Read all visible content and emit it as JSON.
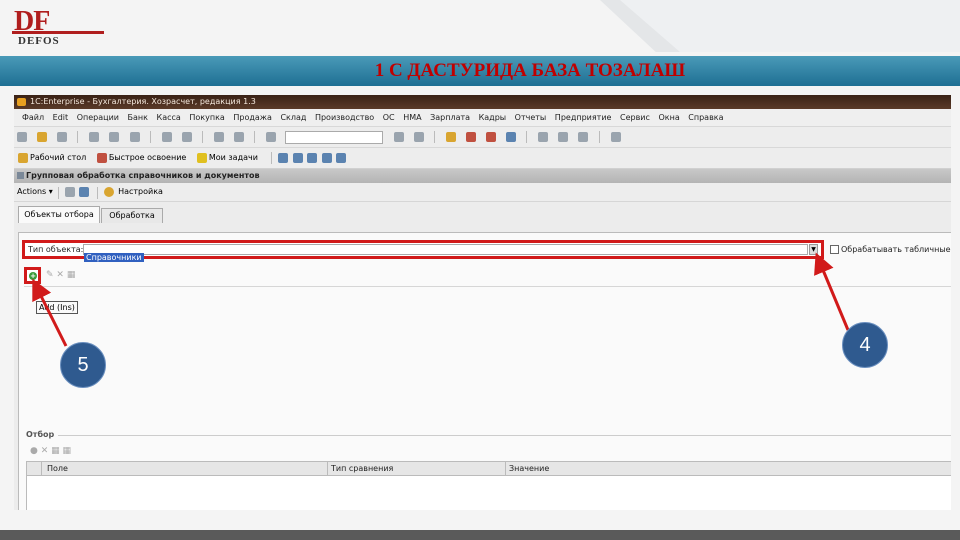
{
  "logo": {
    "big": "DF",
    "small": "DEFOS"
  },
  "slide": {
    "title": "1 С ДАСТУРИДА БАЗА ТОЗАЛАШ"
  },
  "app": {
    "window_title": "1C:Enterprise - Бухгалтерия. Хозрасчет, редакция 1.3",
    "menu": [
      "Файл",
      "Edit",
      "Операции",
      "Банк",
      "Касса",
      "Покупка",
      "Продажа",
      "Склад",
      "Производство",
      "ОС",
      "НМА",
      "Зарплата",
      "Кадры",
      "Отчеты",
      "Предприятие",
      "Сервис",
      "Окна",
      "Справка"
    ],
    "toolbar2": {
      "desktop": "Рабочий стол",
      "quick_start": "Быстрое освоение",
      "my_tasks": "Мои задачи"
    },
    "subwindow_title": "Групповая обработка справочников и документов",
    "actions": {
      "label": "Actions ▾",
      "settings": "Настройка"
    },
    "tabs": [
      {
        "label": "Объекты отбора",
        "active": true
      },
      {
        "label": "Обработка",
        "active": false
      }
    ],
    "object_type": {
      "label": "Тип объекта:",
      "value": "Справочники"
    },
    "checkbox_label": "Обрабатывать табличные ча",
    "tooltip": "Add (Ins)",
    "filter": {
      "label": "Отбор",
      "columns": [
        "Поле",
        "Тип сравнения",
        "Значение"
      ]
    }
  },
  "callouts": {
    "five": "5",
    "four": "4"
  },
  "colors": {
    "banner": "#1e6f93",
    "highlight": "#d11a1a",
    "callout": "#2f5a8f",
    "title_red": "#c00000"
  }
}
